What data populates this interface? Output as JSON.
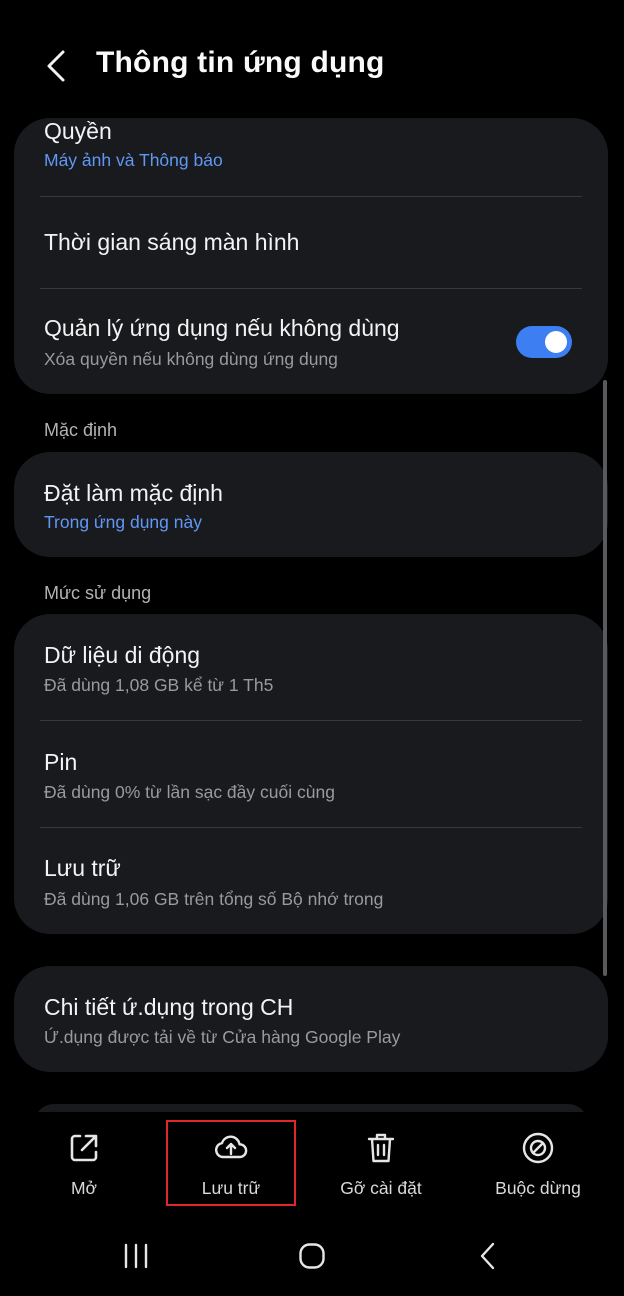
{
  "header": {
    "title": "Thông tin ứng dụng"
  },
  "card1": {
    "permissions": {
      "title": "Quyền",
      "subtitle": "Máy ảnh và Thông báo"
    },
    "screen_time": {
      "title": "Thời gian sáng màn hình"
    },
    "manage_unused": {
      "title": "Quản lý ứng dụng nếu không dùng",
      "subtitle": "Xóa quyền nếu không dùng ứng dụng",
      "toggle_on": true
    }
  },
  "defaults": {
    "section_label": "Mặc định",
    "set_default": {
      "title": "Đặt làm mặc định",
      "subtitle": "Trong ứng dụng này"
    }
  },
  "usage": {
    "section_label": "Mức sử dụng",
    "mobile_data": {
      "title": "Dữ liệu di động",
      "subtitle": "Đã dùng 1,08 GB kể từ 1 Th5"
    },
    "battery": {
      "title": "Pin",
      "subtitle": "Đã dùng 0% từ lần sạc đầy cuối cùng"
    },
    "storage": {
      "title": "Lưu trữ",
      "subtitle": "Đã dùng 1,06 GB trên tổng số Bộ nhớ trong"
    }
  },
  "store_details": {
    "title": "Chi tiết ứ.dụng trong CH",
    "subtitle": "Ứ.dụng được tải về từ Cửa hàng Google Play"
  },
  "bottom_actions": {
    "open": {
      "label": "Mở",
      "icon": "open-external-icon"
    },
    "archive": {
      "label": "Lưu trữ",
      "icon": "cloud-upload-icon"
    },
    "uninstall": {
      "label": "Gỡ cài đặt",
      "icon": "trash-icon"
    },
    "force_stop": {
      "label": "Buộc dừng",
      "icon": "block-icon"
    }
  },
  "colors": {
    "accent": "#3d7ff2",
    "link": "#5f97f5",
    "highlight": "#e0272c",
    "card": "#191a1d"
  }
}
